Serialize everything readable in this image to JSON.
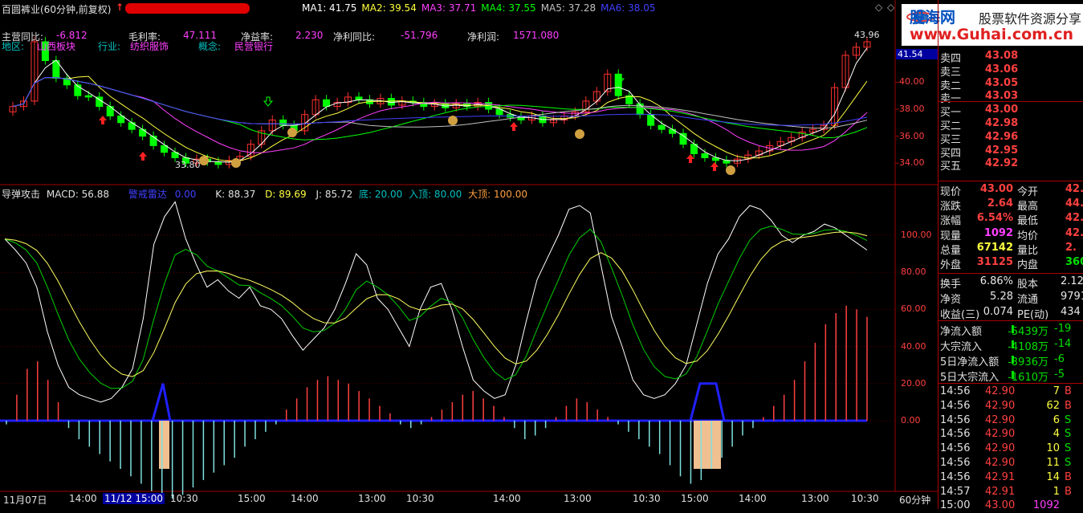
{
  "header": {
    "stock_title": "百圆裤业(60分钟,前复权)",
    "ma": [
      {
        "label": "MA1: 41.75",
        "color": "#ffffff"
      },
      {
        "label": "MA2: 39.54",
        "color": "#ffff40"
      },
      {
        "label": "MA3: 37.71",
        "color": "#ff40ff"
      },
      {
        "label": "MA4: 37.55",
        "color": "#00ff00"
      },
      {
        "label": "MA5: 37.28",
        "color": "#c0c0c0"
      },
      {
        "label": "MA6: 38.05",
        "color": "#4040ff"
      }
    ]
  },
  "fundamentals": {
    "row1": [
      {
        "label": "主营同比:",
        "value": "-6.812"
      },
      {
        "label": "毛利率:",
        "value": "47.111"
      },
      {
        "label": "净益率:",
        "value": "2.230"
      },
      {
        "label": "净利同比:",
        "value": "-51.796"
      },
      {
        "label": "净利润:",
        "value": "1571.080"
      }
    ],
    "row2": [
      {
        "label": "地区:",
        "value": "山西板块"
      },
      {
        "label": "行业:",
        "value": "纺织服饰"
      },
      {
        "label": "概念:",
        "value": "民营银行"
      }
    ]
  },
  "price_axis": [
    "40.00",
    "38.00",
    "36.00",
    "34.00"
  ],
  "price_marks": {
    "high": "43.96",
    "low": "33.80",
    "current": "41.54"
  },
  "indicator": {
    "name": "导弹攻击",
    "macd": "MACD: 56.88",
    "alert_label": "警戒雷达",
    "alert_value": "0.00",
    "k": "K: 88.37",
    "d": "D: 89.69",
    "j": "J: 85.72",
    "bottom": "底: 20.00",
    "top_in": "入顶: 80.00",
    "big_top": "大顶: 100.00"
  },
  "indicator_axis": [
    "100.00",
    "80.00",
    "60.00",
    "40.00",
    "20.00",
    "0.00"
  ],
  "time_axis": [
    "11月07日",
    "14:00",
    "11/12 15:00",
    "10:30",
    "15:00",
    "14:00",
    "13:00",
    "10:30",
    "14:00",
    "13:00",
    "10:30",
    "15:00",
    "14:00",
    "13:00",
    "10:30"
  ],
  "period_label": "60分钟",
  "logo": {
    "brand": "股海网",
    "slogan": "股票软件资源分享",
    "url": "www.Guhai.com.cn"
  },
  "order_book": [
    {
      "label": "卖四",
      "price": "43.08"
    },
    {
      "label": "卖三",
      "price": "43.06"
    },
    {
      "label": "卖二",
      "price": "43.05"
    },
    {
      "label": "卖一",
      "price": "43.03"
    },
    {
      "label": "买一",
      "price": "43.00"
    },
    {
      "label": "买二",
      "price": "42.98"
    },
    {
      "label": "买三",
      "price": "42.96"
    },
    {
      "label": "买四",
      "price": "42.95"
    },
    {
      "label": "买五",
      "price": "42.92"
    }
  ],
  "quote": [
    {
      "l1": "现价",
      "v1": "43.00",
      "l2": "今开",
      "v2": "42."
    },
    {
      "l1": "涨跌",
      "v1": "2.64",
      "l2": "最高",
      "v2": "44."
    },
    {
      "l1": "涨幅",
      "v1": "6.54%",
      "l2": "最低",
      "v2": "42."
    },
    {
      "l1": "现量",
      "v1": "1092",
      "l2": "均价",
      "v2": "42."
    },
    {
      "l1": "总量",
      "v1": "67142",
      "l2": "量比",
      "v2": "2."
    },
    {
      "l1": "外盘",
      "v1": "31125",
      "l2": "内盘",
      "v2": "360"
    }
  ],
  "stats": [
    {
      "l1": "换手",
      "v1": "6.86%",
      "l2": "股本",
      "v2": "2.12"
    },
    {
      "l1": "净资",
      "v1": "5.28",
      "l2": "流通",
      "v2": "9791"
    },
    {
      "l1": "收益(三)",
      "v1": "0.074",
      "l2": "PE(动)",
      "v2": "434"
    }
  ],
  "flows": [
    {
      "label": "净流入额",
      "value": "-5439万",
      "extra": "-19"
    },
    {
      "label": "大宗流入",
      "value": "-4108万",
      "extra": "-14"
    },
    {
      "label": "5日净流入额",
      "value": "-3936万",
      "extra": "-6"
    },
    {
      "label": "5日大宗流入",
      "value": "-1610万",
      "extra": "-5"
    }
  ],
  "ticks": [
    {
      "time": "14:56",
      "price": "42.90",
      "vol": "7",
      "side": "B"
    },
    {
      "time": "14:56",
      "price": "42.90",
      "vol": "62",
      "side": "B"
    },
    {
      "time": "14:56",
      "price": "42.90",
      "vol": "6",
      "side": "S"
    },
    {
      "time": "14:56",
      "price": "42.90",
      "vol": "4",
      "side": "S"
    },
    {
      "time": "14:56",
      "price": "42.90",
      "vol": "10",
      "side": "S"
    },
    {
      "time": "14:56",
      "price": "42.90",
      "vol": "11",
      "side": "S"
    },
    {
      "time": "14:56",
      "price": "42.91",
      "vol": "14",
      "side": "B"
    },
    {
      "time": "14:57",
      "price": "42.91",
      "vol": "1",
      "side": "B"
    },
    {
      "time": "15:00",
      "price": "43.00",
      "vol": "1092",
      "side": ""
    }
  ],
  "colors": {
    "up": "#ff3030",
    "down": "#00e000",
    "grid": "#a00000",
    "kline_up": "#ff3030",
    "kline_down": "#00ff00"
  }
}
